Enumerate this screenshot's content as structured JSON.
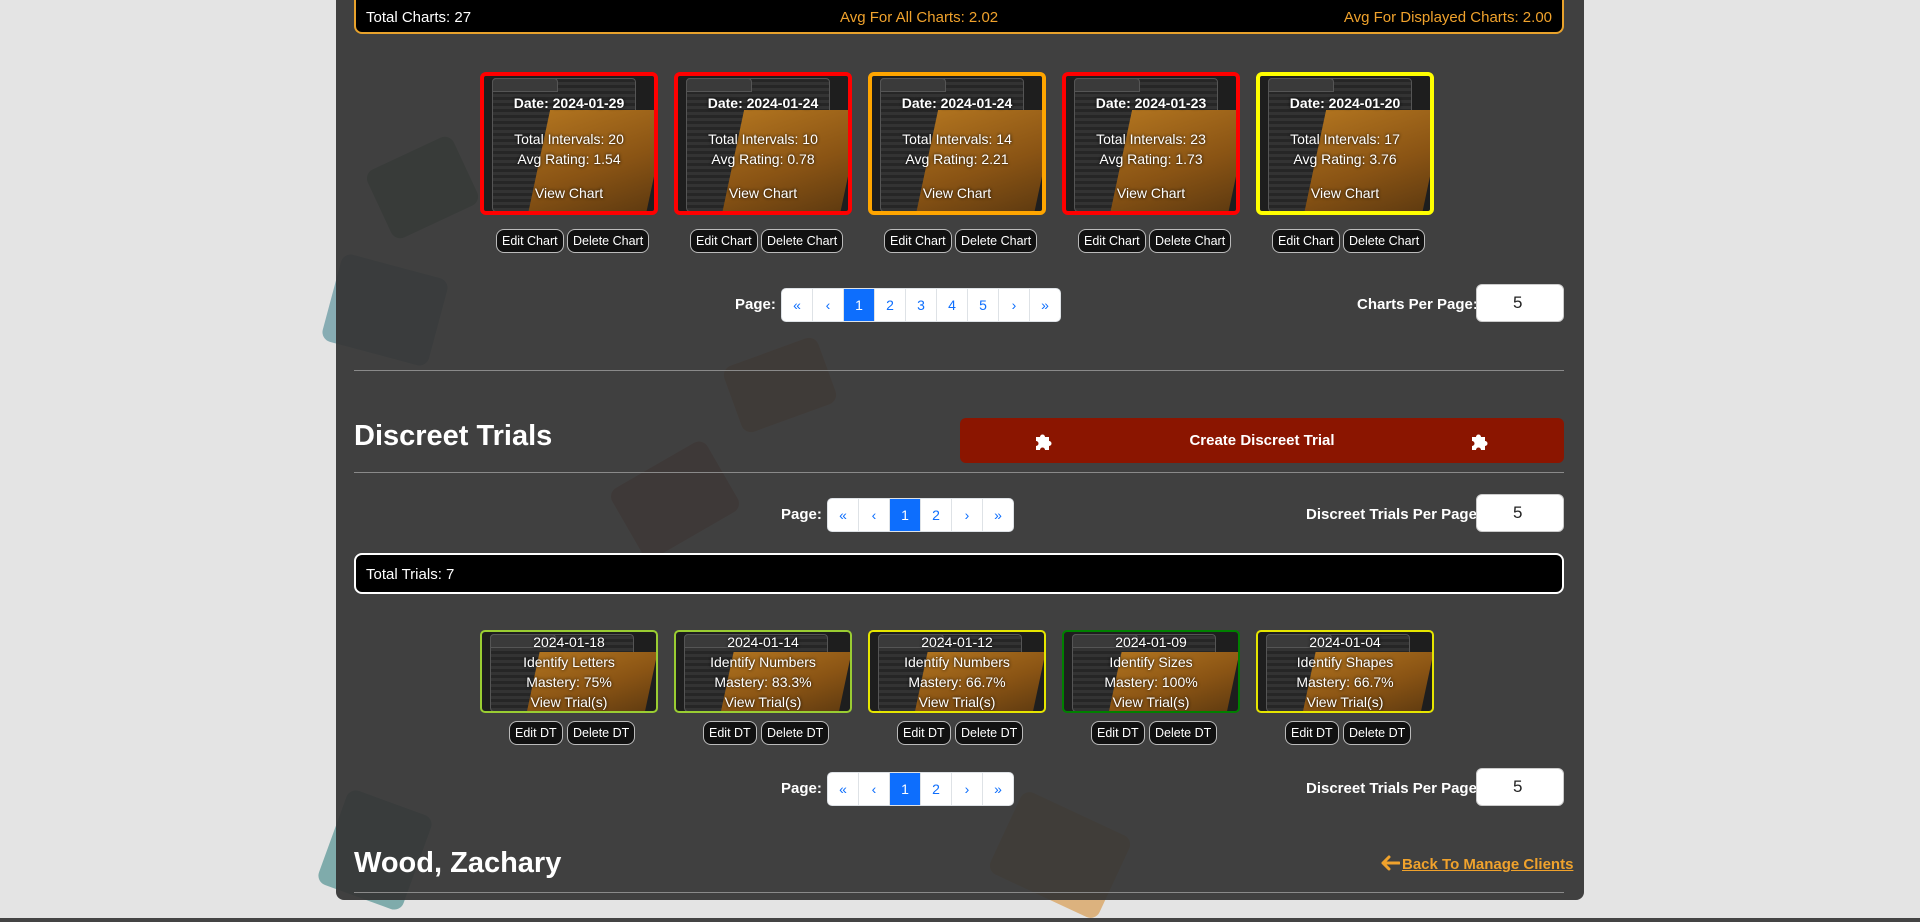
{
  "summary": {
    "total_charts": "Total Charts: 27",
    "avg_all": "Avg For All Charts: 2.02",
    "avg_displayed": "Avg For Displayed Charts: 2.00"
  },
  "charts": [
    {
      "date": "Date: 2024-01-29",
      "intervals": "Total Intervals: 20",
      "rating": "Avg Rating: 1.54",
      "view": "View Chart",
      "border": "#ff0000"
    },
    {
      "date": "Date: 2024-01-24",
      "intervals": "Total Intervals: 10",
      "rating": "Avg Rating: 0.78",
      "view": "View Chart",
      "border": "#ff0000"
    },
    {
      "date": "Date: 2024-01-24",
      "intervals": "Total Intervals: 14",
      "rating": "Avg Rating: 2.21",
      "view": "View Chart",
      "border": "#ffa500"
    },
    {
      "date": "Date: 2024-01-23",
      "intervals": "Total Intervals: 23",
      "rating": "Avg Rating: 1.73",
      "view": "View Chart",
      "border": "#ff0000"
    },
    {
      "date": "Date: 2024-01-20",
      "intervals": "Total Intervals: 17",
      "rating": "Avg Rating: 3.76",
      "view": "View Chart",
      "border": "#ffff00"
    }
  ],
  "chart_buttons": {
    "edit": "Edit Chart",
    "delete": "Delete Chart"
  },
  "charts_pager": {
    "label": "Page:",
    "pages": [
      "«",
      "‹",
      "1",
      "2",
      "3",
      "4",
      "5",
      "›",
      "»"
    ],
    "active": "1",
    "per_page_label": "Charts Per Page:",
    "per_page_value": "5"
  },
  "discreet_trials": {
    "heading": "Discreet Trials",
    "create_label": "Create Discreet Trial",
    "icon": "puzzle-piece-icon"
  },
  "trials_pager": {
    "label": "Page:",
    "pages": [
      "«",
      "‹",
      "1",
      "2",
      "›",
      "»"
    ],
    "active": "1",
    "per_page_label": "Discreet Trials Per Page:",
    "per_page_value": "5"
  },
  "total_trials": "Total Trials: 7",
  "trials": [
    {
      "date": "2024-01-18",
      "name": "Identify Letters",
      "mastery": "Mastery: 75%",
      "view": "View Trial(s)",
      "border": "#9acd32"
    },
    {
      "date": "2024-01-14",
      "name": "Identify Numbers",
      "mastery": "Mastery: 83.3%",
      "view": "View Trial(s)",
      "border": "#9acd32"
    },
    {
      "date": "2024-01-12",
      "name": "Identify Numbers",
      "mastery": "Mastery: 66.7%",
      "view": "View Trial(s)",
      "border": "#e6e600"
    },
    {
      "date": "2024-01-09",
      "name": "Identify Sizes",
      "mastery": "Mastery: 100%",
      "view": "View Trial(s)",
      "border": "#008000"
    },
    {
      "date": "2024-01-04",
      "name": "Identify Shapes",
      "mastery": "Mastery: 66.7%",
      "view": "View Trial(s)",
      "border": "#e6e600"
    }
  ],
  "trial_buttons": {
    "edit": "Edit DT",
    "delete": "Delete DT"
  },
  "client": {
    "name": "Wood, Zachary",
    "back_link": "Back To Manage Clients",
    "back_icon": "arrow-left-icon"
  }
}
